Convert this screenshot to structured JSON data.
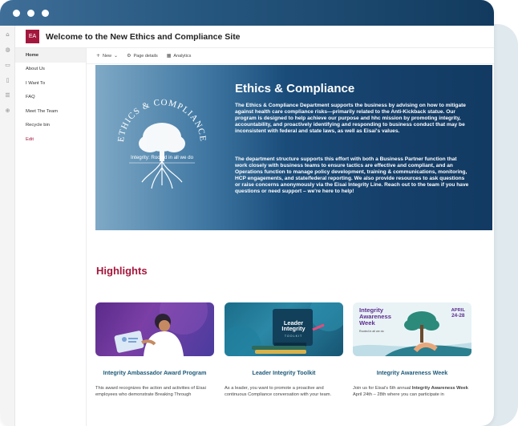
{
  "site": {
    "logo_initials": "EA",
    "title": "Welcome to the New Ethics and Compliance Site"
  },
  "left_nav": {
    "items": [
      {
        "label": "Home"
      },
      {
        "label": "About Us"
      },
      {
        "label": "I Want To"
      },
      {
        "label": "FAQ"
      },
      {
        "label": "Meet The Team"
      },
      {
        "label": "Recycle bin"
      }
    ],
    "edit_label": "Edit"
  },
  "command_bar": {
    "new_label": "New",
    "page_details_label": "Page details",
    "analytics_label": "Analytics"
  },
  "hero": {
    "heading": "Ethics & Compliance",
    "paragraph_1": "The Ethics & Compliance Department supports the business by advising on how to mitigate against health care compliance risks—primarily related to the Anti-Kickback statue. Our program is designed to help achieve our purpose and hhc mission by promoting integrity, accountability, and proactively identifying and responding to business conduct that may be inconsistent with federal and state laws, as well as Eisai's values.",
    "paragraph_2": "The department structure supports this effort with both a Business Partner function that work closely with business teams to ensure tactics are effective and compliant, and an Operations function to manage policy development, training & communications, monitoring, HCP engagements, and state/federal reporting. We also provide resources to ask questions or raise concerns anonymously via the Eisai Integrity Line. Reach out to the team if you have questions or need support – we're here to help!",
    "emblem_text": "ETHICS & COMPLIANCE",
    "emblem_tagline": "Integrity: Rooted in all we do"
  },
  "highlights": {
    "title": "Highlights",
    "cards": [
      {
        "title": "Integrity Ambassador Award Program",
        "text": "This award recognizes the action and activities of Eisai employees who demonstrate Breaking Through"
      },
      {
        "title": "Leader Integrity Toolkit",
        "text": "As a leader, you want to promote a proactive and continuous Compliance conversation with your team.",
        "image_title": "Leader Integrity",
        "image_sub": "TOOLKIT"
      },
      {
        "title": "Integrity Awareness Week",
        "text_prefix": "Join us for Eisai's 6th annual ",
        "text_bold": "Integrity Awareness Week",
        "text_suffix": " April 24th – 28th where you can participate in",
        "image_title_1": "Integrity",
        "image_title_2": "Awareness",
        "image_title_3": "Week",
        "image_tagline": "Rooted in all we do",
        "image_month": "APRIL",
        "image_days": "24-28"
      }
    ]
  },
  "colors": {
    "brand": "#a4173d",
    "title_blue": "#1d5a7a",
    "hero_navy": "#16416c"
  }
}
